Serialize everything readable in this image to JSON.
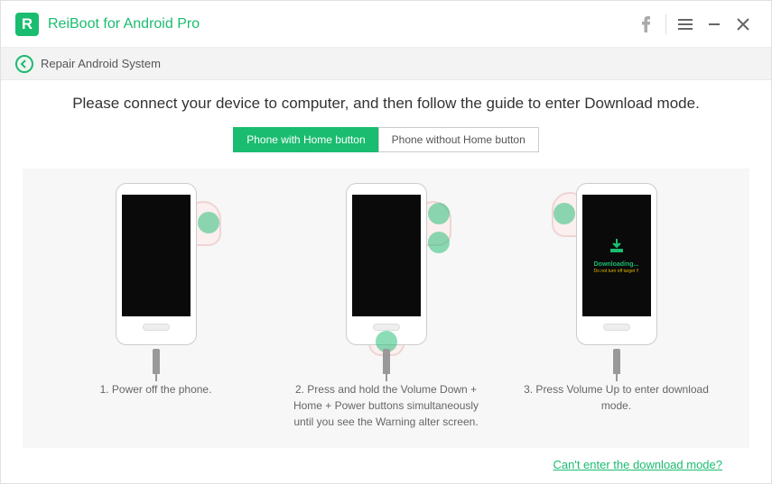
{
  "app": {
    "logo_letter": "R",
    "title": "ReiBoot for Android Pro"
  },
  "breadcrumb": {
    "label": "Repair Android System"
  },
  "main": {
    "instruction": "Please connect your device to computer, and then follow the guide to enter Download mode.",
    "tabs": [
      {
        "label": "Phone with Home button",
        "active": true
      },
      {
        "label": "Phone without Home button",
        "active": false
      }
    ],
    "steps": [
      {
        "caption": "1. Power off the phone."
      },
      {
        "caption": "2. Press and hold the Volume Down + Home + Power buttons simultaneously until you see the Warning alter screen."
      },
      {
        "caption": "3. Press Volume Up to enter download mode."
      }
    ],
    "downloading_screen": {
      "text": "Downloading...",
      "warning": "Do not turn off target !!"
    },
    "footer_link": "Can't enter the download mode?"
  }
}
